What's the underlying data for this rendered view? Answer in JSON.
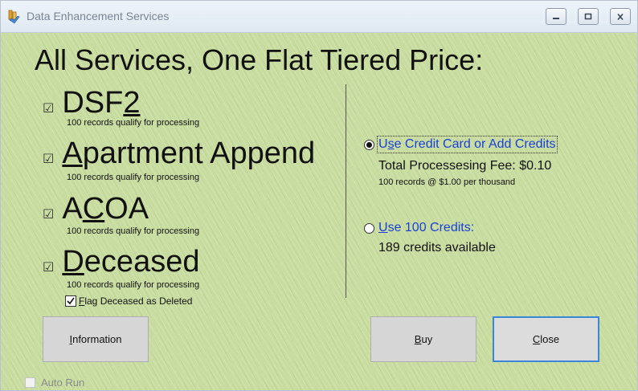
{
  "window": {
    "title": "Data Enhancement Services",
    "icon": "app-tools-icon",
    "controls": [
      "minimize-icon",
      "maximize-icon",
      "close-icon"
    ]
  },
  "headline": "All Services, One Flat Tiered Price:",
  "services": [
    {
      "pre": "DSF",
      "key": "2",
      "post": "",
      "checked": true,
      "qualify": "100 records qualify for processing"
    },
    {
      "pre": "",
      "key": "A",
      "post": "partment Append",
      "checked": true,
      "qualify": "100 records qualify for processing"
    },
    {
      "pre": "A",
      "key": "C",
      "post": "OA",
      "checked": true,
      "qualify": "100 records qualify for processing"
    },
    {
      "pre": "",
      "key": "D",
      "post": "eceased",
      "checked": true,
      "qualify": "100 records qualify for processing"
    }
  ],
  "flag_deceased": {
    "key": "F",
    "rest": "lag Deceased as Deleted",
    "checked": true
  },
  "payment_options": {
    "credit_card": {
      "pre": "U",
      "key": "s",
      "post": "e Credit Card or Add Credits",
      "selected": true,
      "fee": "Total Processesing Fee: $0.10",
      "rate": "100 records @ $1.00 per thousand"
    },
    "credits": {
      "pre": "",
      "key": "U",
      "post": "se 100 Credits:",
      "selected": false,
      "available": "189 credits available"
    }
  },
  "buttons": {
    "information": {
      "key": "I",
      "rest": "nformation"
    },
    "buy": {
      "key": "B",
      "rest": "uy"
    },
    "close": {
      "key": "C",
      "rest": "lose"
    }
  },
  "auto_run": {
    "label": "Auto Run",
    "checked": false
  },
  "colors": {
    "background": "#c8dca0",
    "link": "#1a3fd8",
    "default_button_border": "#3a86d8"
  }
}
